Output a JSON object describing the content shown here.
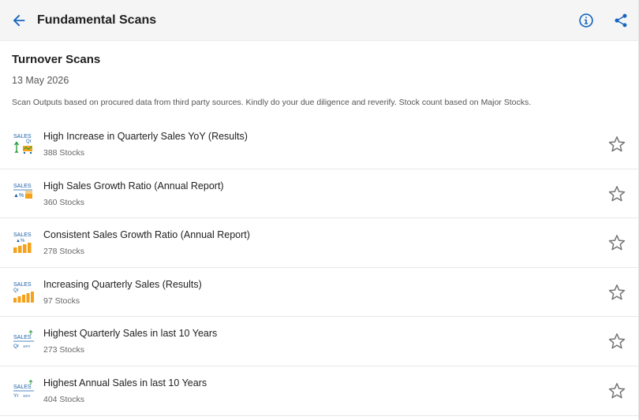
{
  "header": {
    "title": "Fundamental Scans"
  },
  "section": {
    "title": "Turnover Scans",
    "date": "13 May 2026",
    "disclaimer": "Scan Outputs based on procured data from third party sources. Kindly do your due diligence and reverify. Stock count based on Major Stocks."
  },
  "scans": [
    {
      "name": "High Increase in Quarterly Sales YoY (Results)",
      "count": "388 Stocks",
      "icon": "sales-qr-yoy-icon",
      "icon_text": "SALES",
      "icon_sub": "Qr"
    },
    {
      "name": "High Sales Growth Ratio (Annual Report)",
      "count": "360 Stocks",
      "icon": "sales-growth-ratio-icon",
      "icon_text": "SALES",
      "icon_sub": "▲%"
    },
    {
      "name": "Consistent Sales Growth Ratio (Annual Report)",
      "count": "278 Stocks",
      "icon": "sales-consistent-growth-icon",
      "icon_text": "SALES",
      "icon_sub": "▲%"
    },
    {
      "name": "Increasing Quarterly Sales (Results)",
      "count": "97 Stocks",
      "icon": "sales-quarterly-increasing-icon",
      "icon_text": "SALES",
      "icon_sub": "Qr"
    },
    {
      "name": "Highest Quarterly Sales in last 10 Years",
      "count": "273 Stocks",
      "icon": "sales-highest-quarterly-icon",
      "icon_text": "SALES",
      "icon_sub": "Qr",
      "icon_tag": "10Yr"
    },
    {
      "name": "Highest Annual Sales in last 10 Years",
      "count": "404 Stocks",
      "icon": "sales-highest-annual-icon",
      "icon_text": "SALES",
      "icon_sub": "Yr",
      "icon_tag": "10Yr"
    }
  ],
  "colors": {
    "accent": "#1565c0",
    "icon_blue": "#1a5fa8",
    "bar_orange": "#f4a21c",
    "arrow_green": "#2e9e3e",
    "star": "#757575"
  }
}
